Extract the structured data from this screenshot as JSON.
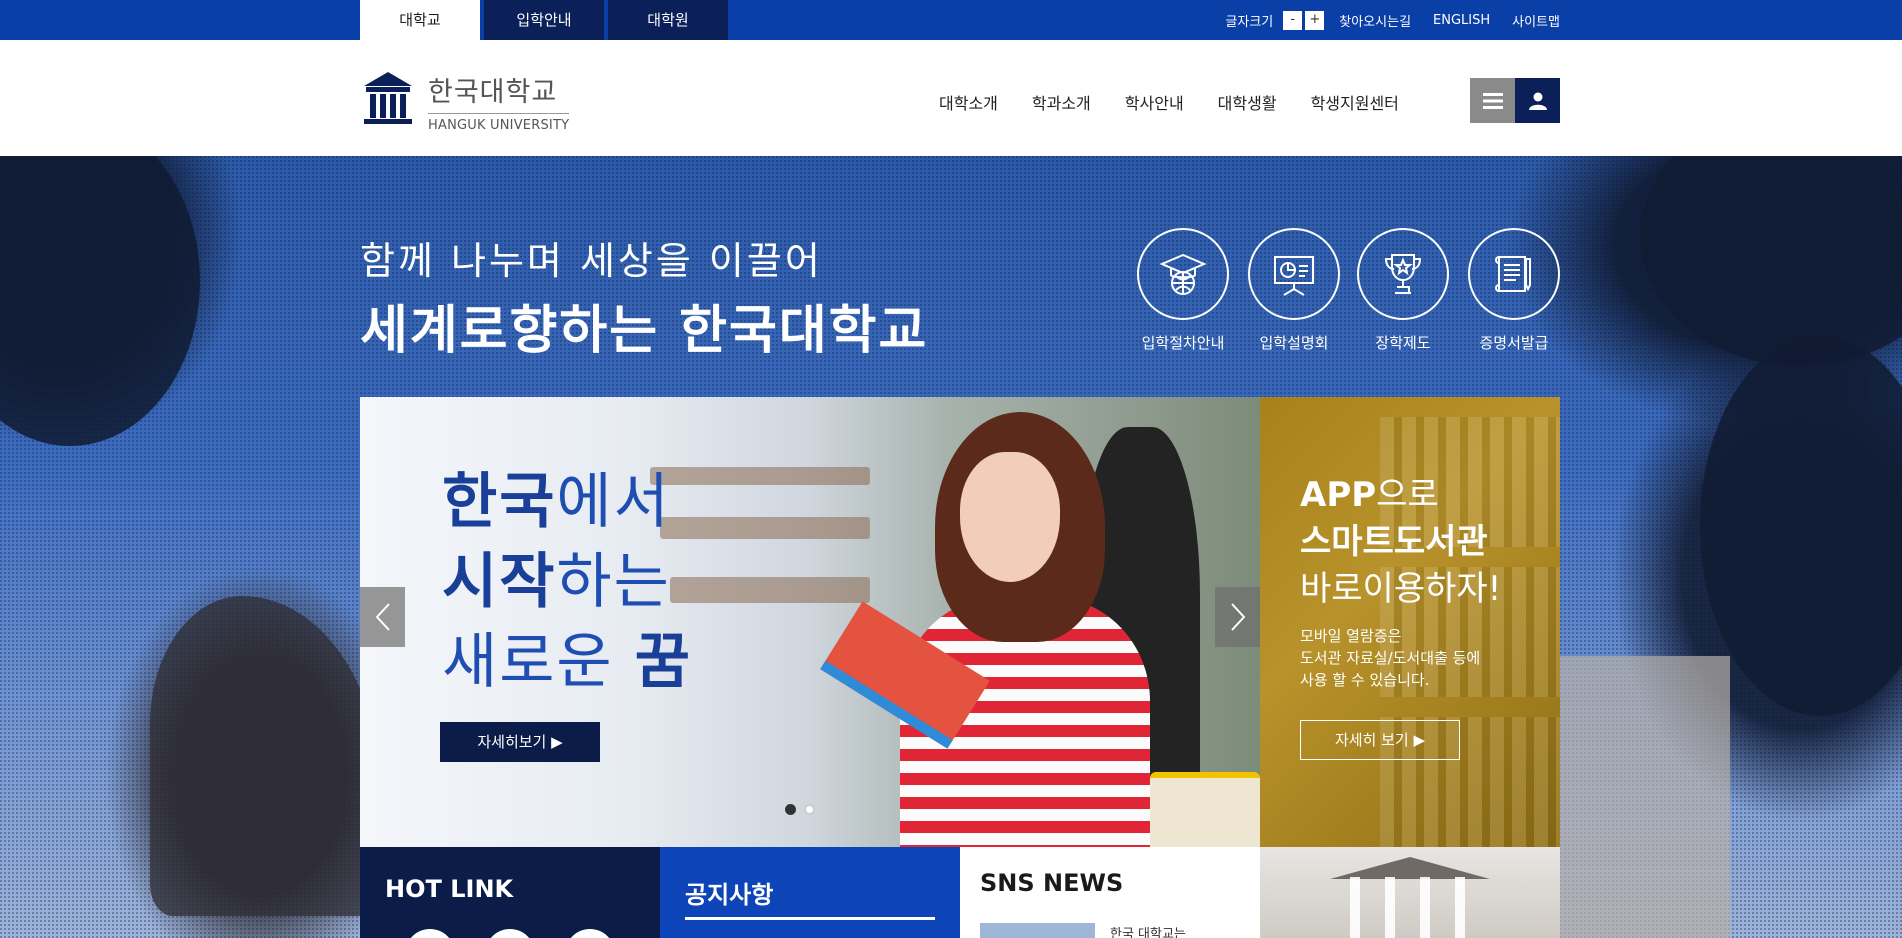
{
  "top_tabs": [
    {
      "label": "대학교",
      "active": true
    },
    {
      "label": "입학안내",
      "active": false
    },
    {
      "label": "대학원",
      "active": false
    }
  ],
  "utility": {
    "font_size_label": "글자크기",
    "minus": "-",
    "plus": "+",
    "directions": "찾아오시는길",
    "english": "ENGLISH",
    "sitemap": "사이트맵"
  },
  "logo": {
    "ko": "한국대학교",
    "en": "HANGUK UNIVERSITY"
  },
  "gnb": [
    "대학소개",
    "학과소개",
    "학사안내",
    "대학생활",
    "학생지원센터"
  ],
  "header_buttons": {
    "menu_icon": "hamburger-icon",
    "user_icon": "user-icon"
  },
  "hero": {
    "subtitle": "함께 나누며 세상을 이끌어",
    "title": "세계로향하는 한국대학교"
  },
  "quick_links": [
    {
      "label": "입학절차안내",
      "icon": "graduation-globe-icon"
    },
    {
      "label": "입학설명회",
      "icon": "presentation-board-icon"
    },
    {
      "label": "장학제도",
      "icon": "trophy-icon"
    },
    {
      "label": "증명서발급",
      "icon": "certificate-scroll-icon"
    }
  ],
  "slide": {
    "line1_bold": "한국",
    "line1_rest": "에서",
    "line2_bold": "시작",
    "line2_rest": "하는",
    "line3_rest": "새로운 ",
    "line3_bold": "꿈",
    "button": "자세히보기 ▶",
    "dots": 2,
    "active_dot": 1
  },
  "app_panel": {
    "line1_bold": "APP",
    "line1_rest": "으로",
    "line2": "스마트도서관",
    "line3": "바로이용하자!",
    "desc1": "모바일 열람증은",
    "desc2": "도서관 자료실/도서대출 등에",
    "desc3": "사용 할 수 있습니다.",
    "button": "자세히 보기 ▶"
  },
  "bottom": {
    "hotlink_title": "HOT LINK",
    "notice_title": "공지사항",
    "sns_title": "SNS NEWS",
    "sns_item_text": "한국 대학교는"
  },
  "colors": {
    "top_bar": "#0a3fa8",
    "navy": "#0b2058",
    "accent_blue": "#1f4eb2",
    "gold": "#a7821a"
  }
}
